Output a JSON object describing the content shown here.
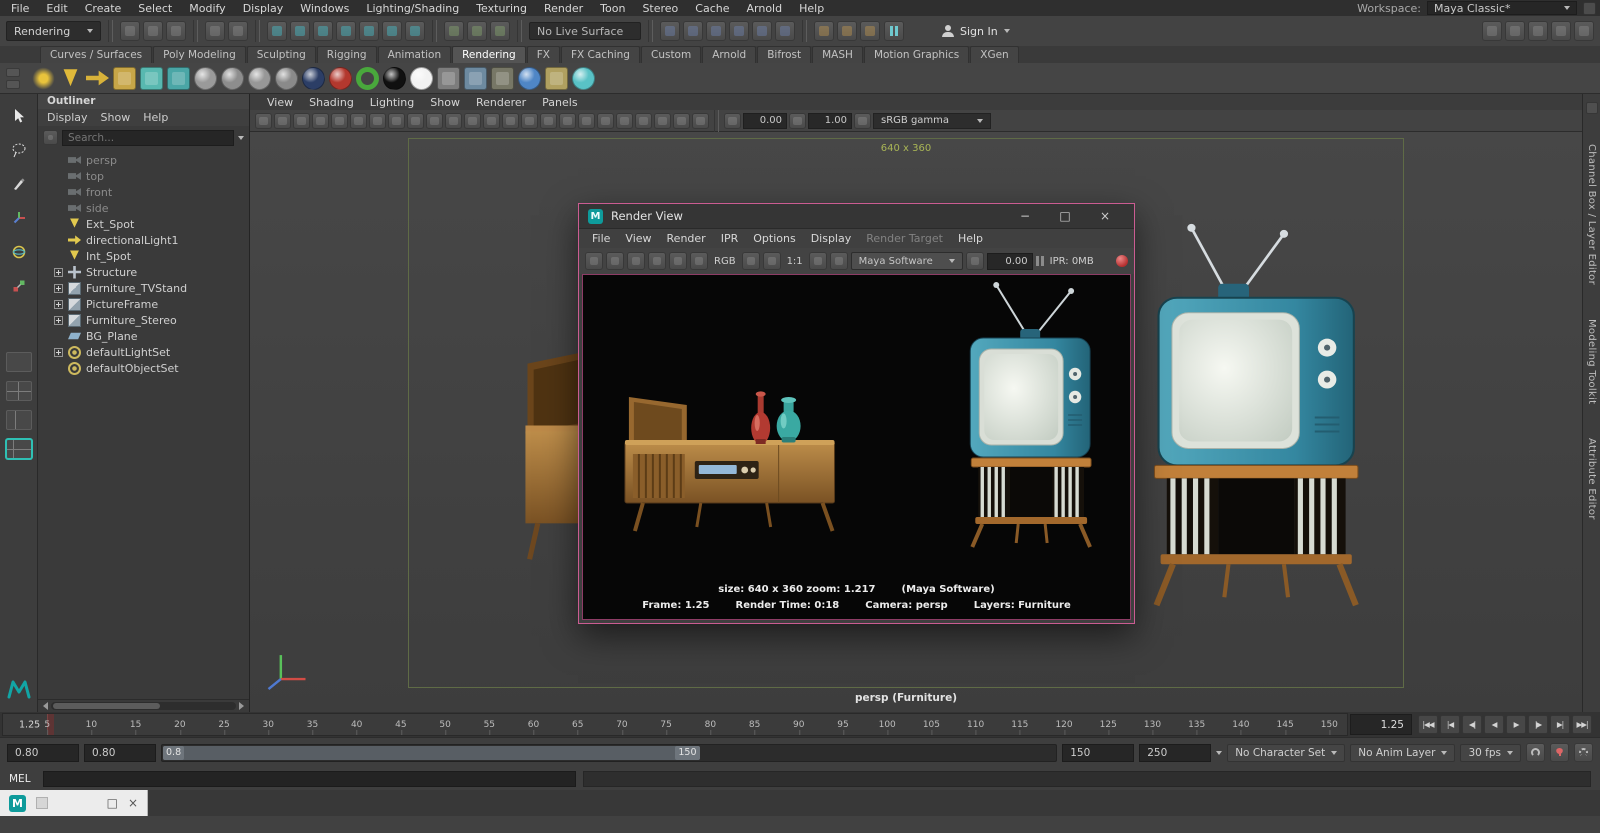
{
  "menubar": {
    "items": [
      "File",
      "Edit",
      "Create",
      "Select",
      "Modify",
      "Display",
      "Windows",
      "Lighting/Shading",
      "Texturing",
      "Render",
      "Toon",
      "Stereo",
      "Cache",
      "Arnold",
      "Help"
    ],
    "workspace_label": "Workspace:",
    "workspace_value": "Maya Classic*"
  },
  "statusline": {
    "menuset": "Rendering",
    "file_icons": [
      "new-scene-icon",
      "open-scene-icon",
      "save-scene-icon"
    ],
    "undo_icons": [
      "undo-icon",
      "redo-icon"
    ],
    "snap_icons": [
      "snap-to-grid-icon",
      "snap-to-curve-icon",
      "snap-to-point-icon",
      "snap-to-projected-center-icon",
      "snap-to-view-plane-icon",
      "make-live-icon",
      "snap-together-icon"
    ],
    "history_icons": [
      "construction-history-icon",
      "highlight-selection-icon",
      "object-details-icon"
    ],
    "live_surface": "No Live Surface",
    "scene_icons": [
      "render-setup-icon",
      "light-editor-icon",
      "hypershade-icon",
      "render-layer-icon",
      "texture-view-icon",
      "uv-editor-icon"
    ],
    "render_icons": [
      "render-current-frame-icon",
      "ipr-render-icon",
      "render-settings-icon"
    ],
    "sign_in": "Sign In",
    "sidebar_icons": [
      "modeling-toolkit-toggle-icon",
      "humanik-toggle-icon",
      "attribute-editor-toggle-icon",
      "tool-settings-toggle-icon",
      "channel-box-toggle-icon"
    ]
  },
  "shelf": {
    "active_tab": "Rendering",
    "tabs": [
      "Curves / Surfaces",
      "Poly Modeling",
      "Sculpting",
      "Rigging",
      "Animation",
      "Rendering",
      "FX",
      "FX Caching",
      "Custom",
      "Arnold",
      "Bifrost",
      "MASH",
      "Motion Graphics",
      "XGen"
    ],
    "icons": [
      {
        "name": "point-light-icon",
        "shape": "burst",
        "color": "#e8c33c"
      },
      {
        "name": "spot-light-icon",
        "shape": "cone",
        "color": "#e0b93a"
      },
      {
        "name": "directional-light-icon",
        "shape": "arrow",
        "color": "#d8b23a"
      },
      {
        "name": "area-light-icon",
        "shape": "box",
        "color": "#c7a648"
      },
      {
        "name": "shading-map-icon",
        "shape": "box",
        "color": "#58b8b0"
      },
      {
        "name": "render-node-icon",
        "shape": "box",
        "color": "#4aa6a6"
      },
      {
        "name": "standard-surface-icon",
        "shape": "ball",
        "color": "#9a9a9a"
      },
      {
        "name": "blinn-material-icon",
        "shape": "ball",
        "color": "#8d8d8d"
      },
      {
        "name": "lambert-material-icon",
        "shape": "ball",
        "color": "#979797"
      },
      {
        "name": "phong-material-icon",
        "shape": "ball",
        "color": "#8a8a8a"
      },
      {
        "name": "ocean-shader-icon",
        "shape": "ball",
        "color": "#2c3e66"
      },
      {
        "name": "anisotropic-material-icon",
        "shape": "ball",
        "color": "#b3382e"
      },
      {
        "name": "ramp-shader-icon",
        "shape": "ring",
        "color": "#49a83c"
      },
      {
        "name": "black-hole-material-icon",
        "shape": "ball",
        "color": "#101010"
      },
      {
        "name": "surface-shader-icon",
        "shape": "ball",
        "color": "#f2f2f2"
      },
      {
        "name": "checker-texture-icon",
        "shape": "box",
        "color": "#7d7d7d"
      },
      {
        "name": "file-texture-icon",
        "shape": "box",
        "color": "#6d8aa0"
      },
      {
        "name": "noise-texture-icon",
        "shape": "box",
        "color": "#777766"
      },
      {
        "name": "env-ball-icon",
        "shape": "ball",
        "color": "#4f86c6"
      },
      {
        "name": "light-linking-icon",
        "shape": "box",
        "color": "#b0a060"
      },
      {
        "name": "glass-material-icon",
        "shape": "ball",
        "color": "#59c2c6"
      }
    ]
  },
  "outliner": {
    "title": "Outliner",
    "menus": [
      "Display",
      "Show",
      "Help"
    ],
    "search_placeholder": "Search...",
    "items": [
      {
        "label": "persp",
        "type": "camera",
        "state": "dim",
        "exp": ""
      },
      {
        "label": "top",
        "type": "camera",
        "state": "dim",
        "exp": ""
      },
      {
        "label": "front",
        "type": "camera",
        "state": "dim",
        "exp": ""
      },
      {
        "label": "side",
        "type": "camera",
        "state": "dim",
        "exp": ""
      },
      {
        "label": "Ext_Spot",
        "type": "spotlight",
        "state": "",
        "exp": ""
      },
      {
        "label": "directionalLight1",
        "type": "dirlight",
        "state": "",
        "exp": ""
      },
      {
        "label": "Int_Spot",
        "type": "spotlight",
        "state": "",
        "exp": ""
      },
      {
        "label": "Structure",
        "type": "transform",
        "state": "",
        "exp": "expandable"
      },
      {
        "label": "Furniture_TVStand",
        "type": "mesh",
        "state": "",
        "exp": "expandable"
      },
      {
        "label": "PictureFrame",
        "type": "mesh",
        "state": "",
        "exp": "expandable"
      },
      {
        "label": "Furniture_Stereo",
        "type": "mesh",
        "state": "",
        "exp": "expandable"
      },
      {
        "label": "BG_Plane",
        "type": "plane",
        "state": "",
        "exp": ""
      },
      {
        "label": "defaultLightSet",
        "type": "set",
        "state": "",
        "exp": "expandable"
      },
      {
        "label": "defaultObjectSet",
        "type": "set",
        "state": "",
        "exp": ""
      }
    ]
  },
  "viewport": {
    "menus": [
      "View",
      "Shading",
      "Lighting",
      "Show",
      "Renderer",
      "Panels"
    ],
    "toolbar_icons": [
      "select-camera-icon",
      "lock-camera-icon",
      "camera-attributes-icon",
      "bookmark-icon",
      "image-plane-icon",
      "two-d-pan-zoom-icon",
      "grease-pencil-icon",
      "grid-icon",
      "film-gate-icon",
      "resolution-gate-icon",
      "gate-mask-icon",
      "field-chart-icon",
      "safe-action-icon",
      "safe-title-icon",
      "frame-all-icon",
      "frame-selection-icon",
      "default-lighting-icon",
      "all-lights-icon",
      "shadows-icon",
      "ambient-occlusion-icon",
      "motion-blur-icon",
      "anti-aliasing-icon",
      "depth-of-field-icon",
      "isolate-select-icon"
    ],
    "exposure": "0.00",
    "gamma": "1.00",
    "colorspace": "sRGB gamma",
    "gate_label": "640 x 360",
    "camera_label": "persp (Furniture)"
  },
  "render_view": {
    "title": "Render View",
    "window_buttons": {
      "minimize": "−",
      "maximize": "□",
      "close": "×"
    },
    "menus": [
      {
        "label": "File",
        "state": ""
      },
      {
        "label": "View",
        "state": ""
      },
      {
        "label": "Render",
        "state": ""
      },
      {
        "label": "IPR",
        "state": ""
      },
      {
        "label": "Options",
        "state": ""
      },
      {
        "label": "Display",
        "state": ""
      },
      {
        "label": "Render Target",
        "state": "disabled"
      },
      {
        "label": "Help",
        "state": ""
      }
    ],
    "toolbar_icons": [
      "redo-previous-render-icon",
      "render-region-icon",
      "snapshot-icon",
      "ipr-render-icon",
      "refresh-ipr-region-icon",
      "render-sequence-icon"
    ],
    "rgb_label": "RGB",
    "channel_icons": [
      "display-rgb-icon",
      "display-alpha-icon"
    ],
    "ratio_label": "1:1",
    "image_icons": [
      "keep-image-icon",
      "remove-image-icon"
    ],
    "renderer": "Maya Software",
    "exposure": "0.00",
    "ipr_label": "IPR: 0MB",
    "status_line1": [
      "size: 640 x 360 zoom: 1.217",
      "(Maya Software)"
    ],
    "status_line2": [
      "Frame: 1.25",
      "Render Time: 0:18",
      "Camera: persp",
      "Layers: Furniture"
    ]
  },
  "right_tabs": [
    "Channel Box / Layer Editor",
    "Modeling Toolkit",
    "Attribute Editor"
  ],
  "timeline": {
    "ticks": [
      5,
      10,
      15,
      20,
      25,
      30,
      35,
      40,
      45,
      50,
      55,
      60,
      65,
      70,
      75,
      80,
      85,
      90,
      95,
      100,
      105,
      110,
      115,
      120,
      125,
      130,
      135,
      140,
      145,
      150
    ],
    "ruler_max": 152,
    "playhead_label": "1.25",
    "current_time": "1.25",
    "transport": [
      {
        "name": "go-to-start-button",
        "glyph": "|◀◀"
      },
      {
        "name": "step-back-one-key-button",
        "glyph": "|◀"
      },
      {
        "name": "step-back-one-frame-button",
        "glyph": "◀|"
      },
      {
        "name": "play-backwards-button",
        "glyph": "◀"
      },
      {
        "name": "play-forwards-button",
        "glyph": "▶"
      },
      {
        "name": "step-forward-one-frame-button",
        "glyph": "|▶"
      },
      {
        "name": "step-forward-one-key-button",
        "glyph": "▶|"
      },
      {
        "name": "go-to-end-button",
        "glyph": "▶▶|"
      }
    ]
  },
  "range": {
    "anim_start": "0.80",
    "play_start": "0.80",
    "range_start": "0.8",
    "range_end": "150",
    "play_end": "150",
    "anim_end": "250",
    "character_set": "No Character Set",
    "anim_layer": "No Anim Layer",
    "fps": "30 fps"
  },
  "command_line": {
    "label": "MEL"
  },
  "taskbar": {
    "restore": "□",
    "close": "×"
  }
}
